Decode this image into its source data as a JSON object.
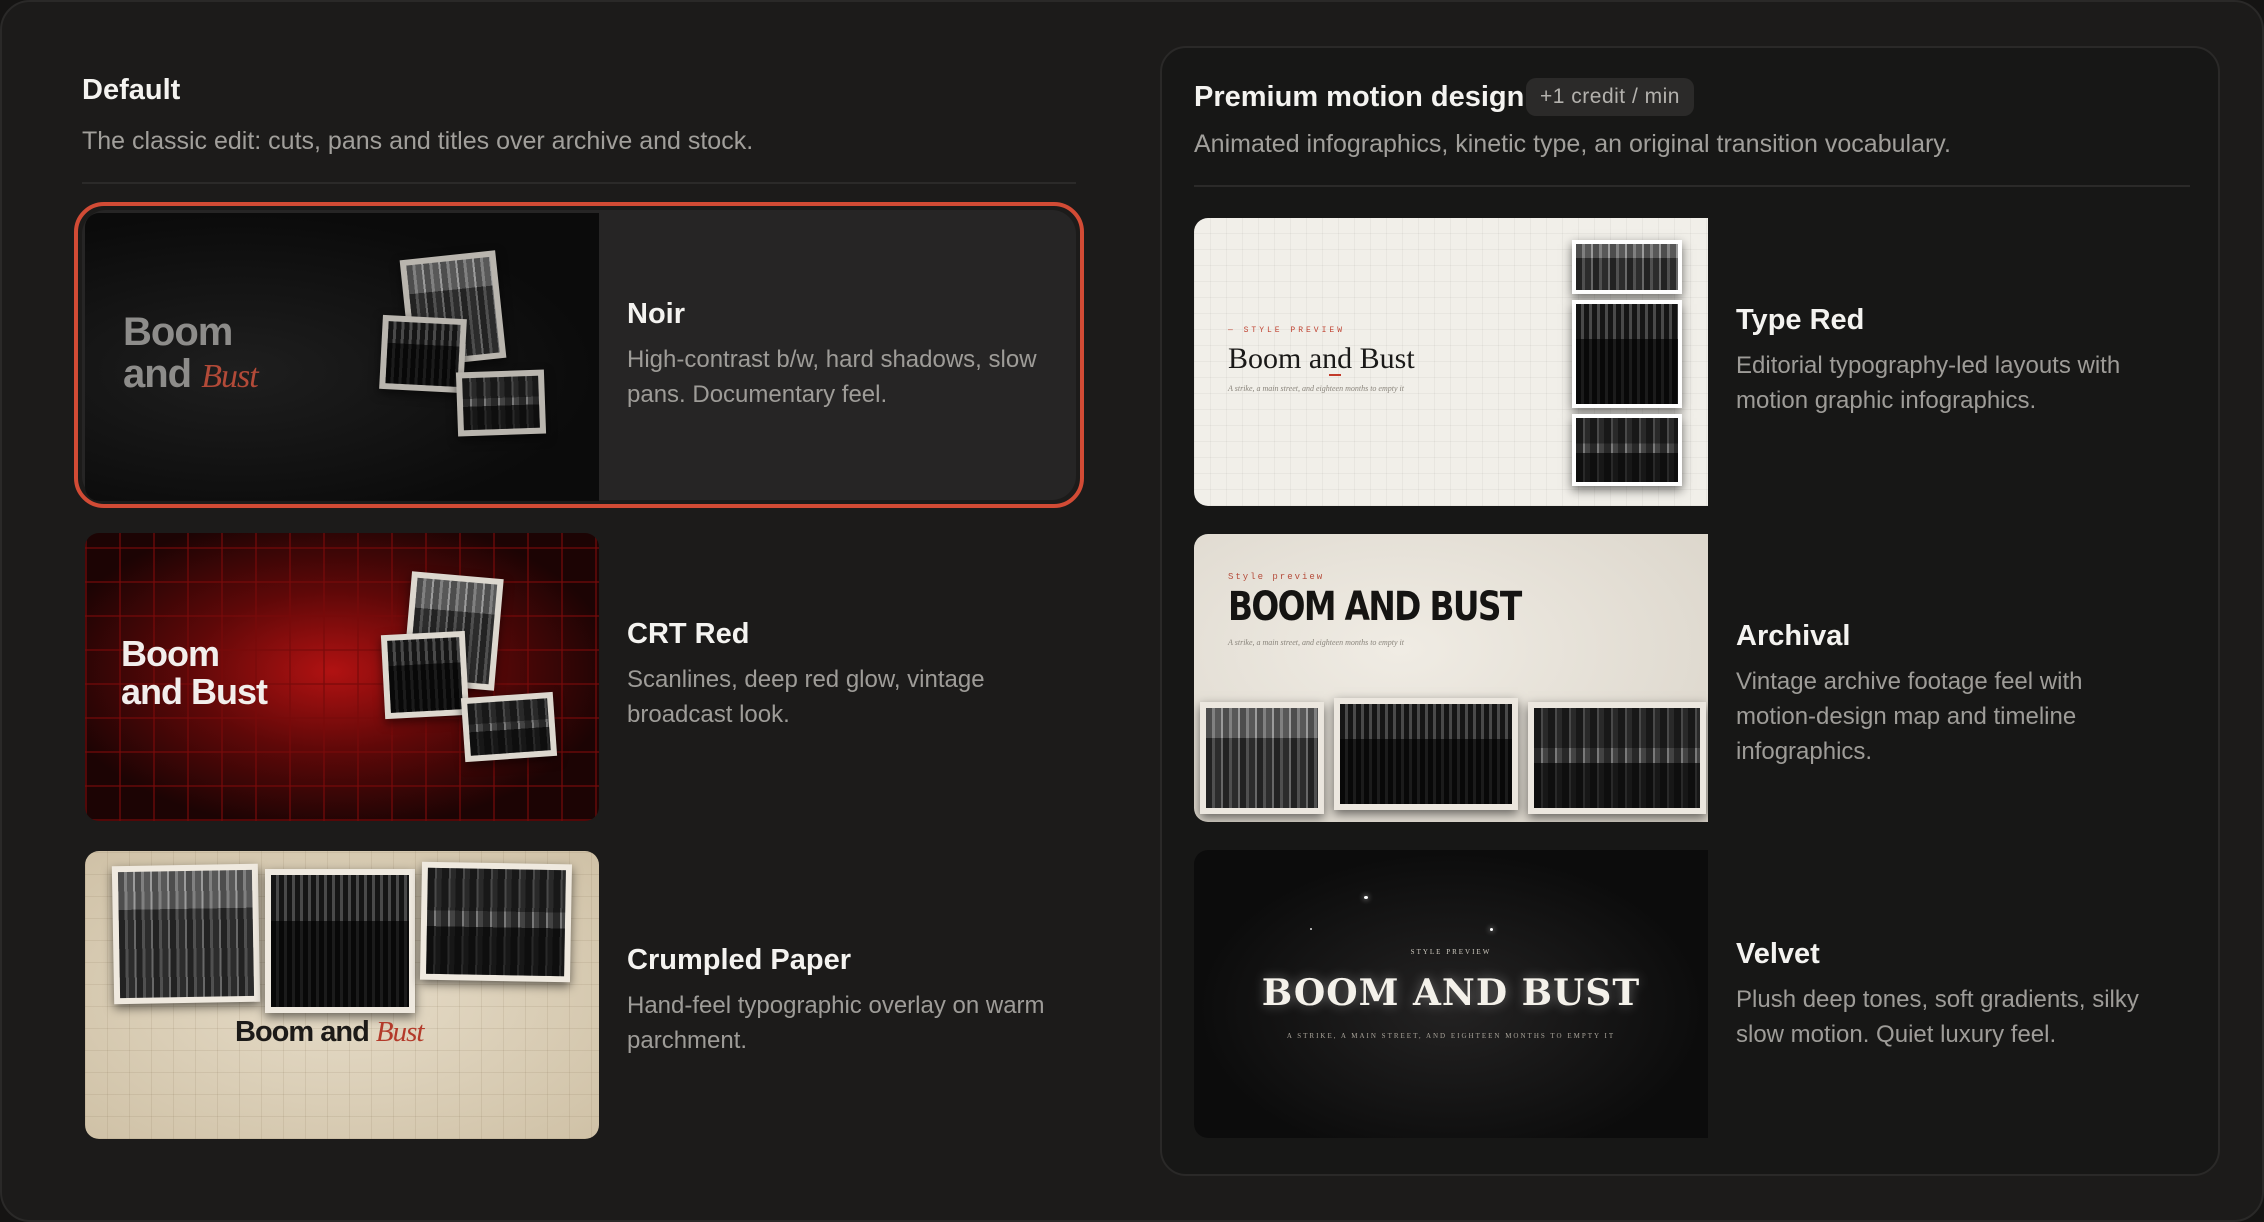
{
  "default_section": {
    "title": "Default",
    "subtitle": "The classic edit: cuts, pans and titles over archive and stock."
  },
  "premium_section": {
    "title": "Premium motion design",
    "badge": "+1 credit / min",
    "subtitle": "Animated infographics, kinetic type, an original transition vocabulary."
  },
  "preview": {
    "title_word_1": "Boom",
    "title_word_2": "and",
    "title_word_3": "Bust",
    "title_line_2": "and Bust",
    "title_full": "Boom and Bust",
    "title_caps": "BOOM AND BUST",
    "kicker_caps": "— STYLE PREVIEW",
    "kicker": "Style preview",
    "kicker_small_caps": "STYLE PREVIEW",
    "tagline": "A strike, a main street, and eighteen months to empty it",
    "tagline_short": "A strike, a main street, and eighteen months to empty it",
    "tagline_caps": "A STRIKE, A MAIN STREET, AND EIGHTEEN MONTHS TO EMPTY IT"
  },
  "default_styles": [
    {
      "name": "Noir",
      "description": "High-contrast b/w, hard shadows, slow pans. Documentary feel.",
      "selected": true
    },
    {
      "name": "CRT Red",
      "description": "Scanlines, deep red glow, vintage broadcast look.",
      "selected": false
    },
    {
      "name": "Crumpled Paper",
      "description": "Hand-feel typographic overlay on warm parchment.",
      "selected": false
    }
  ],
  "premium_styles": [
    {
      "name": "Type Red",
      "description": "Editorial typography-led layouts with motion graphic infographics."
    },
    {
      "name": "Archival",
      "description": "Vintage archive footage feel with motion-design map and timeline infographics."
    },
    {
      "name": "Velvet",
      "description": "Plush deep tones, soft gradients, silky slow motion. Quiet luxury feel."
    }
  ],
  "colors": {
    "accent": "#d24b35",
    "background": "#1c1b1a",
    "panel": "#171716"
  }
}
